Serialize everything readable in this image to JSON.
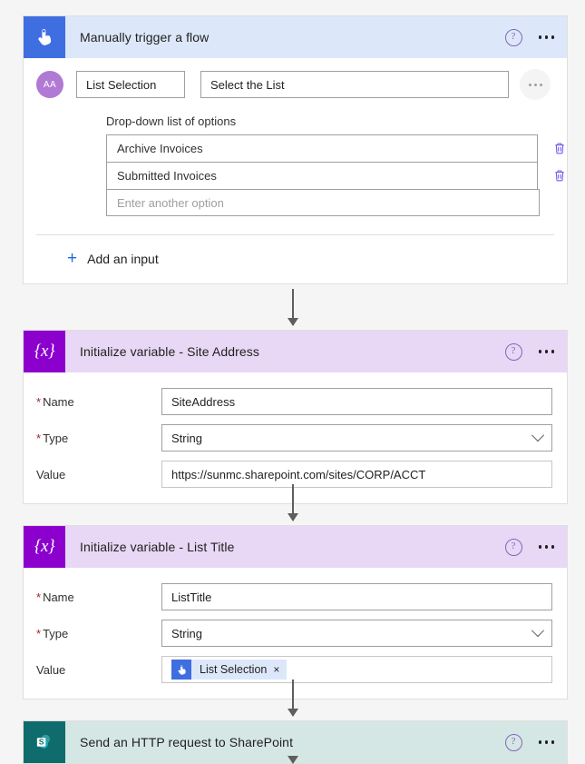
{
  "flow": {
    "trigger": {
      "icon_name": "manual-trigger-icon",
      "title": "Manually trigger a flow",
      "help_label": "?",
      "more_label": "...",
      "input": {
        "avatar_label": "AA",
        "title_value": "List Selection",
        "description_value": "Select the List",
        "more_label": "..."
      },
      "dropdown": {
        "label": "Drop-down list of options",
        "options": [
          {
            "value": "Archive Invoices",
            "delete_label": "delete"
          },
          {
            "value": "Submitted Invoices",
            "delete_label": "delete"
          }
        ],
        "new_option_placeholder": "Enter another option"
      },
      "add_input_label": "Add an input",
      "add_input_plus": "+"
    },
    "actions": [
      {
        "icon_name": "variable-icon",
        "icon_glyph": "{x}",
        "title": "Initialize variable - Site Address",
        "help_label": "?",
        "more_label": "...",
        "fields": {
          "name_label": "Name",
          "name_value": "SiteAddress",
          "type_label": "Type",
          "type_value": "String",
          "value_label": "Value",
          "value_text": "https://sunmc.sharepoint.com/sites/CORP/ACCT",
          "required_marker": "*"
        }
      },
      {
        "icon_name": "variable-icon",
        "icon_glyph": "{x}",
        "title": "Initialize variable - List Title",
        "help_label": "?",
        "more_label": "...",
        "fields": {
          "name_label": "Name",
          "name_value": "ListTitle",
          "type_label": "Type",
          "type_value": "String",
          "value_label": "Value",
          "required_marker": "*",
          "value_token": {
            "icon_name": "manual-trigger-icon",
            "label": "List Selection",
            "remove_label": "×"
          }
        }
      },
      {
        "icon_name": "sharepoint-icon",
        "title": "Send an HTTP request to SharePoint",
        "help_label": "?",
        "more_label": "..."
      }
    ]
  },
  "colors": {
    "trigger_header": "#dce8fa",
    "trigger_icon": "#3f6ee0",
    "variable_header": "#e8d7f5",
    "variable_icon": "#8c00cd",
    "sharepoint_header": "#d5e7e5",
    "sharepoint_icon": "#106c6c",
    "accent_link": "#2266dd",
    "help_purple": "#8764b8",
    "required_red": "#a4262c",
    "canvas_bg": "#f5f5f5"
  }
}
